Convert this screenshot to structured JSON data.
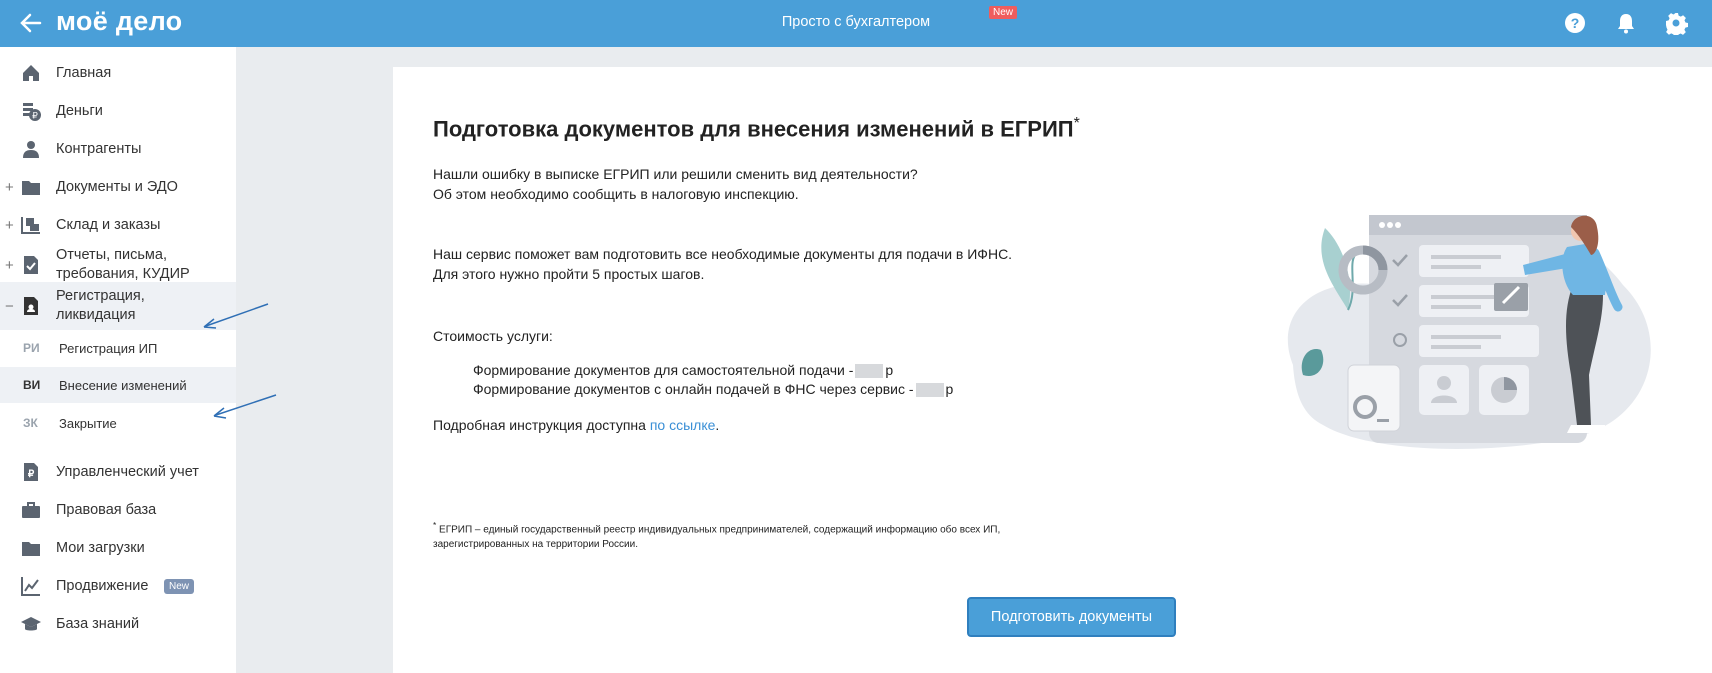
{
  "header": {
    "logo": "моё дело",
    "title": "Просто с бухгалтером",
    "new_badge": "New"
  },
  "sidebar": {
    "items": [
      {
        "label": "Главная",
        "icon": "home-icon"
      },
      {
        "label": "Деньги",
        "icon": "money-icon"
      },
      {
        "label": "Контрагенты",
        "icon": "contractor-icon"
      },
      {
        "label": "Документы и ЭДО",
        "icon": "folder-icon",
        "expand": "+"
      },
      {
        "label": "Склад и заказы",
        "icon": "warehouse-icon",
        "expand": "+"
      },
      {
        "label_line1": "Отчеты, письма,",
        "label_line2": "требования, КУДИР",
        "icon": "report-icon",
        "expand": "+"
      },
      {
        "label_line1": "Регистрация,",
        "label_line2": "ликвидация",
        "icon": "registration-icon",
        "expand": "−"
      }
    ],
    "sub_items": [
      {
        "abbr": "РИ",
        "label": "Регистрация ИП"
      },
      {
        "abbr": "ВИ",
        "label": "Внесение изменений"
      },
      {
        "abbr": "ЗК",
        "label": "Закрытие"
      }
    ],
    "bottom_items": [
      {
        "label": "Управленческий учет",
        "icon": "ruble-doc-icon"
      },
      {
        "label": "Правовая база",
        "icon": "briefcase-icon"
      },
      {
        "label": "Мои загрузки",
        "icon": "folder-icon"
      },
      {
        "label": "Продвижение",
        "icon": "chart-icon",
        "badge": "New"
      },
      {
        "label": "База знаний",
        "icon": "graduation-cap-icon"
      }
    ]
  },
  "content": {
    "title": "Подготовка документов для внесения изменений в ЕГРИП",
    "title_sup": "*",
    "para1_line1": "Нашли ошибку в выписке ЕГРИП или решили сменить вид деятельности?",
    "para1_line2": "Об этом необходимо сообщить в налоговую инспекцию.",
    "para2_line1": "Наш сервис поможет вам подготовить все необходимые документы для подачи в ИФНС.",
    "para2_line2": "Для этого нужно пройти 5 простых шагов.",
    "cost_label": "Стоимость услуги:",
    "cost1": "Формирование документов для самостоятельной подачи -",
    "cost2": "Формирование документов с онлайн подачей в ФНС через сервис -",
    "currency": "р",
    "instruction": "Подробная инструкция доступна ",
    "instruction_link": "по ссылке",
    "instruction_end": ".",
    "footnote_mark": "*",
    "footnote": " ЕГРИП – единый государственный реестр индивидуальных предпринимателей, содержащий информацию обо всех ИП, зарегистрированных на территории России.",
    "button": "Подготовить документы"
  },
  "colors": {
    "header": "#4a9fd8",
    "accent": "#4a9fd8",
    "link": "#3a8fd6",
    "badge_new_red": "#ef5d5d",
    "badge_new_gray": "#7e93b3"
  }
}
